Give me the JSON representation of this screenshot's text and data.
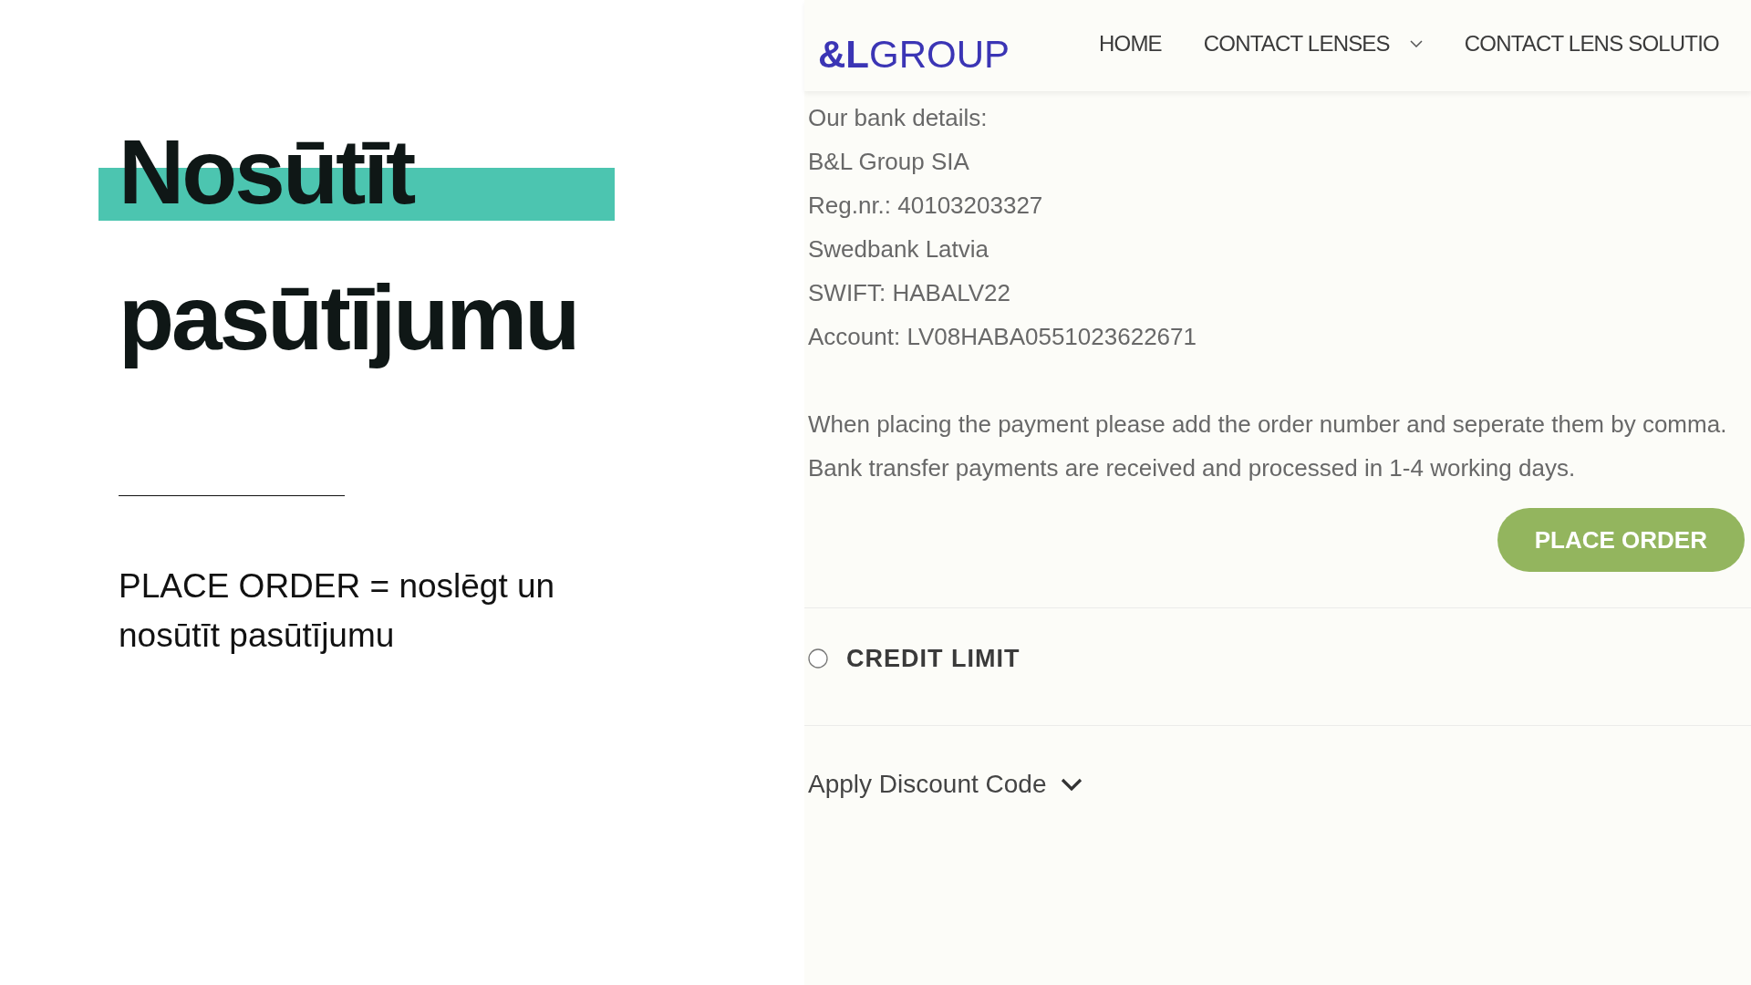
{
  "slide": {
    "title": [
      {
        "text": "Nosūtīt",
        "highlighted": true
      },
      {
        "text": "pasūtījumu",
        "highlighted": false
      }
    ],
    "caption": "PLACE ORDER = noslēgt un nosūtīt pasūtījumu"
  },
  "website": {
    "logo": "**&L**GROUP",
    "nav": [
      {
        "label": "HOME",
        "has_dropdown": false
      },
      {
        "label": "CONTACT LENSES",
        "has_dropdown": true
      },
      {
        "label": "CONTACT LENS SOLUTIO",
        "has_dropdown": false
      }
    ],
    "bank_details": [
      "Our bank details:",
      "B&L Group SIA",
      "Reg.nr.: 40103203327",
      "Swedbank Latvia",
      "SWIFT: HABALV22",
      "Account: LV08HABA0551023622671"
    ],
    "payment_notes": [
      "When placing the payment please add the order number and seperate them by comma.",
      "Bank transfer payments are received and processed in 1-4 working days."
    ],
    "place_order_button": "PLACE ORDER",
    "payment_methods": [
      {
        "label": "CREDIT LIMIT",
        "selected": false
      }
    ],
    "discount": {
      "label": "Apply Discount Code",
      "expanded": false
    }
  }
}
